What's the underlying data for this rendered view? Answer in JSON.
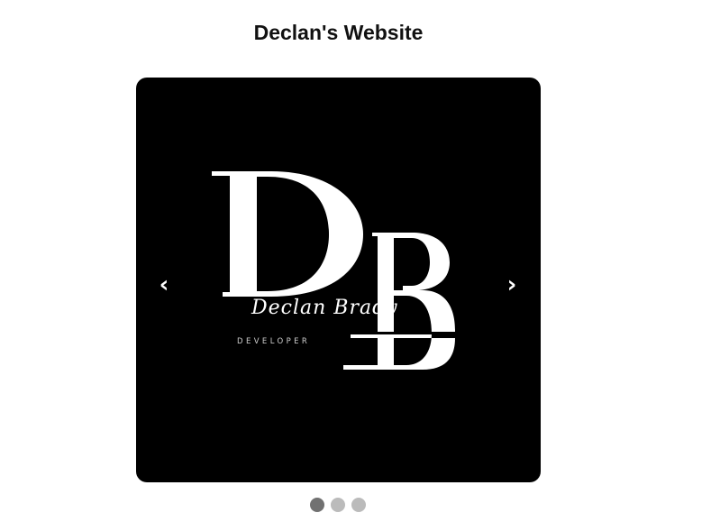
{
  "page": {
    "title": "Declan's Website"
  },
  "carousel": {
    "slide": {
      "logo_monogram": "DB",
      "logo_name": "Declan Brady",
      "logo_role": "DEVELOPER"
    },
    "prev_label": "‹",
    "next_label": "›",
    "dots": [
      {
        "active": true
      },
      {
        "active": false
      },
      {
        "active": false
      }
    ],
    "current_slide": 1,
    "total_slides": 3
  },
  "colors": {
    "slide_background": "#000000",
    "dot_active": "#717171",
    "dot_inactive": "#bbbbbb"
  }
}
